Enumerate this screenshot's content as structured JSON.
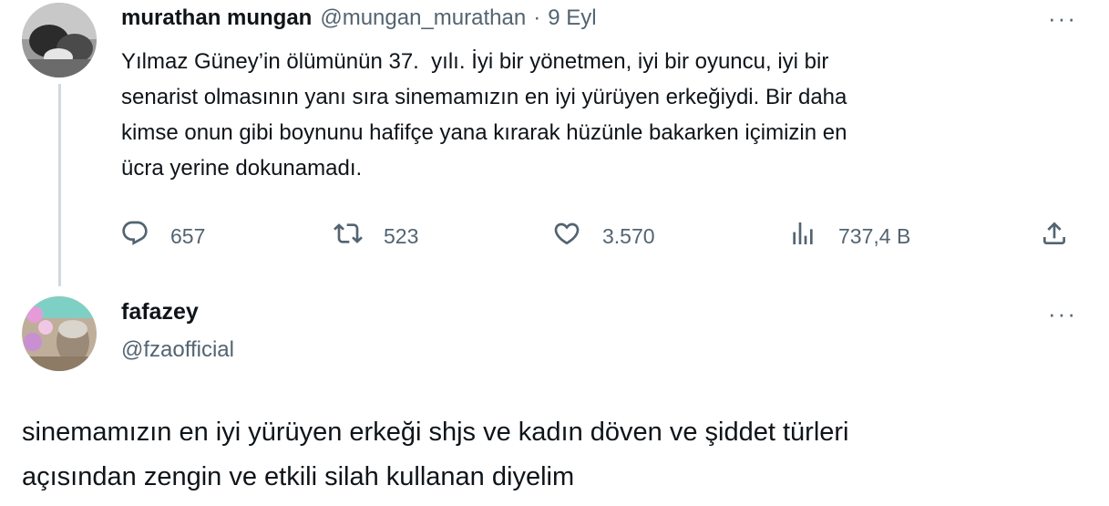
{
  "tweet": {
    "author_name": "murathan mungan",
    "handle": "@mungan_murathan",
    "separator": "·",
    "time": "9 Eyl",
    "more_label": "···",
    "text": "Yılmaz Güney’in ölümünün 37.  yılı. İyi bir yönetmen, iyi bir oyuncu, iyi bir\nsenarist olmasının yanı sıra sinemamızın en iyi yürüyen erkeğiydi. Bir daha\nkimse onun gibi boynunu hafifçe yana kırarak hüzünle bakarken içimizin en\nücra yerine dokunamadı.",
    "actions": {
      "replies": "657",
      "retweets": "523",
      "likes": "3.570",
      "views": "737,4 B"
    },
    "icons": [
      "reply-icon",
      "retweet-icon",
      "like-icon",
      "views-icon",
      "share-icon"
    ]
  },
  "reply": {
    "author_name": "fafazey",
    "handle": "@fzaofficial",
    "more_label": "···",
    "text": "sinemamızın en iyi yürüyen erkeği shjs ve kadın döven ve şiddet türleri\naçısından zengin ve etkili silah kullanan diyelim"
  },
  "colors": {
    "text_primary": "#0f1419",
    "text_secondary": "#536471",
    "thread_line": "#cfd9de",
    "background": "#ffffff"
  }
}
